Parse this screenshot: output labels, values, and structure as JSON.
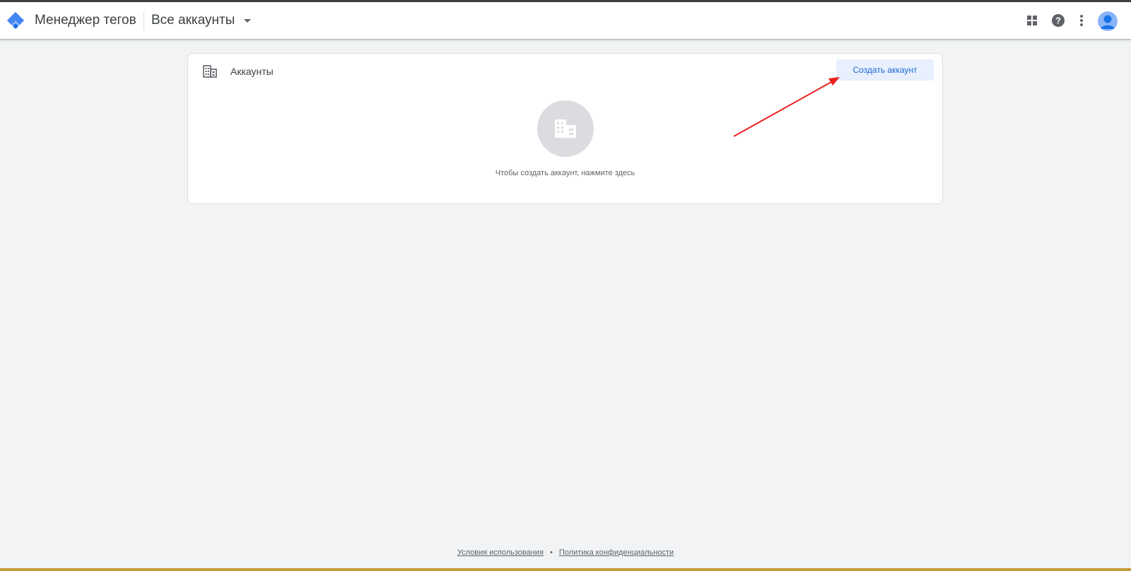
{
  "header": {
    "app_title": "Менеджер тегов",
    "account_selector": "Все аккаунты",
    "icons": [
      "tag-manager-logo",
      "apps-grid-icon",
      "help-icon",
      "more-vert-icon",
      "account-avatar"
    ]
  },
  "accounts_card": {
    "title": "Аккаунты",
    "create_button": "Создать аккаунт",
    "empty_state": "Чтобы создать аккаунт, нажмите здесь",
    "icons": [
      "building-icon"
    ]
  },
  "footer": {
    "terms": "Условия использования",
    "separator": "•",
    "privacy": "Политика конфиденциальности"
  },
  "colors": {
    "page_background": "#f1f3f4",
    "accent": "#1967d2",
    "button_background": "#e8f0fe",
    "annotation_arrow": "#e8231e"
  }
}
